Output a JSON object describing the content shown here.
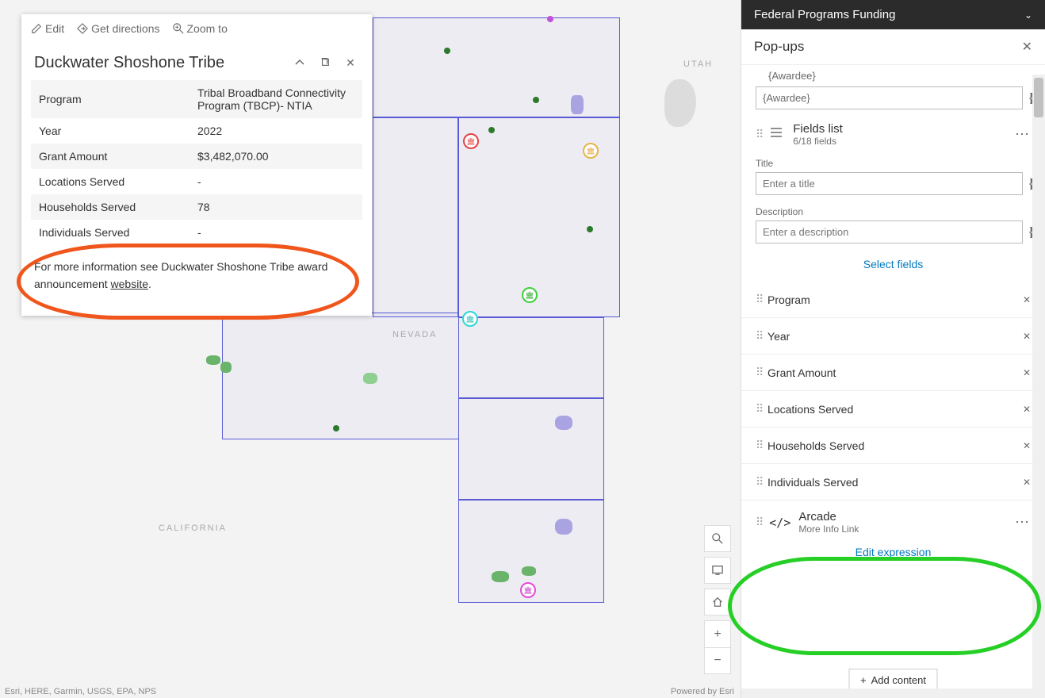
{
  "map": {
    "labels": {
      "california": "CALIFORNIA",
      "nevada": "NEVADA",
      "utah": "UTAH"
    },
    "credits": "Esri, HERE, Garmin, USGS, EPA, NPS",
    "powered": "Powered by Esri"
  },
  "popup": {
    "toolbar": {
      "edit": "Edit",
      "directions": "Get directions",
      "zoom": "Zoom to"
    },
    "title": "Duckwater Shoshone Tribe",
    "fields": [
      {
        "label": "Program",
        "value": "Tribal Broadband Connectivity Program (TBCP)- NTIA"
      },
      {
        "label": "Year",
        "value": "2022"
      },
      {
        "label": "Grant Amount",
        "value": "$3,482,070.00"
      },
      {
        "label": "Locations Served",
        "value": "-"
      },
      {
        "label": "Households Served",
        "value": "78"
      },
      {
        "label": "Individuals Served",
        "value": "-"
      }
    ],
    "note_prefix": "For more information see Duckwater Shoshone Tribe award announcement ",
    "note_link": "website",
    "note_suffix": "."
  },
  "panel": {
    "header": "Federal Programs Funding",
    "section": "Pop-ups",
    "awardee_label": "{Awardee}",
    "awardee_input": "{Awardee}",
    "fields_list": {
      "title": "Fields list",
      "subtitle": "6/18 fields"
    },
    "title_label": "Title",
    "title_placeholder": "Enter a title",
    "desc_label": "Description",
    "desc_placeholder": "Enter a description",
    "select_fields": "Select fields",
    "field_items": [
      "Program",
      "Year",
      "Grant Amount",
      "Locations Served",
      "Households Served",
      "Individuals Served"
    ],
    "arcade": {
      "title": "Arcade",
      "subtitle": "More Info Link"
    },
    "edit_expression": "Edit expression",
    "add_content": "Add content"
  }
}
